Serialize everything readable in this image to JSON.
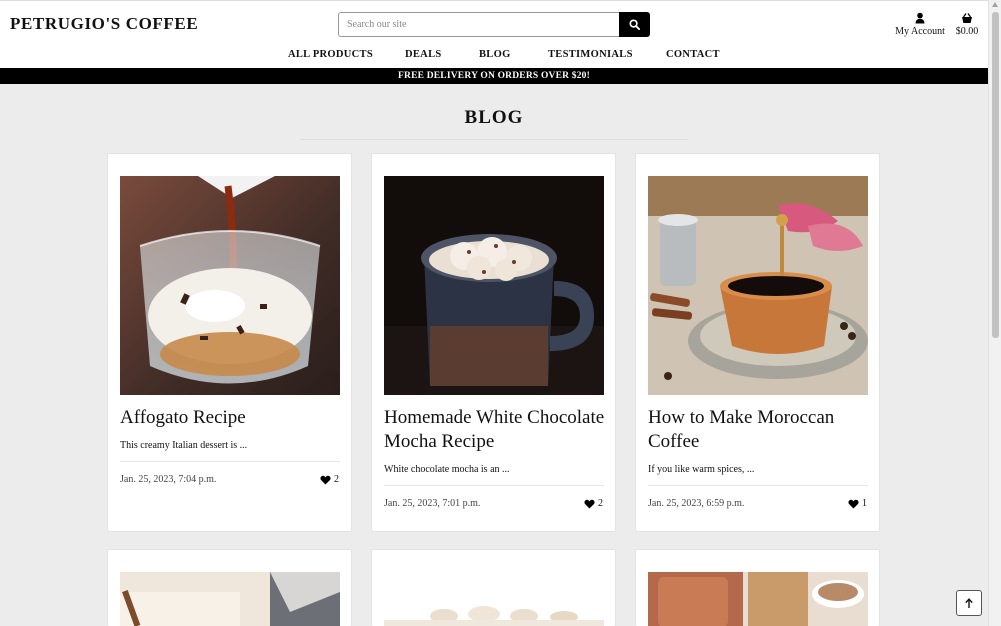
{
  "brand": {
    "title": "PETRUGIO'S COFFEE"
  },
  "search": {
    "placeholder": "Search our site",
    "icon": "search-icon"
  },
  "account": {
    "label": "My Account",
    "icon": "user-icon"
  },
  "bag": {
    "total": "$0.00",
    "icon": "shopping-basket-icon"
  },
  "nav": {
    "items": [
      "ALL PRODUCTS",
      "DEALS",
      "BLOG",
      "TESTIMONIALS",
      "CONTACT"
    ]
  },
  "banner": {
    "text": "FREE DELIVERY ON ORDERS OVER $20!"
  },
  "page": {
    "title": "BLOG"
  },
  "posts": [
    {
      "title": "Affogato Recipe",
      "excerpt": "This creamy Italian dessert is ...",
      "date": "Jan. 25, 2023, 7:04 p.m.",
      "likes": "2"
    },
    {
      "title": "Homemade White Chocolate Mocha Recipe",
      "excerpt": "White chocolate mocha is an ...",
      "date": "Jan. 25, 2023, 7:01 p.m.",
      "likes": "2"
    },
    {
      "title": "How to Make Moroccan Coffee",
      "excerpt": "If you like warm spices, ...",
      "date": "Jan. 25, 2023, 6:59 p.m.",
      "likes": "1"
    }
  ],
  "colors": {
    "accent": "#000000",
    "background": "#ececec",
    "card": "#ffffff"
  },
  "back_to_top": {
    "icon": "arrow-up-icon"
  }
}
